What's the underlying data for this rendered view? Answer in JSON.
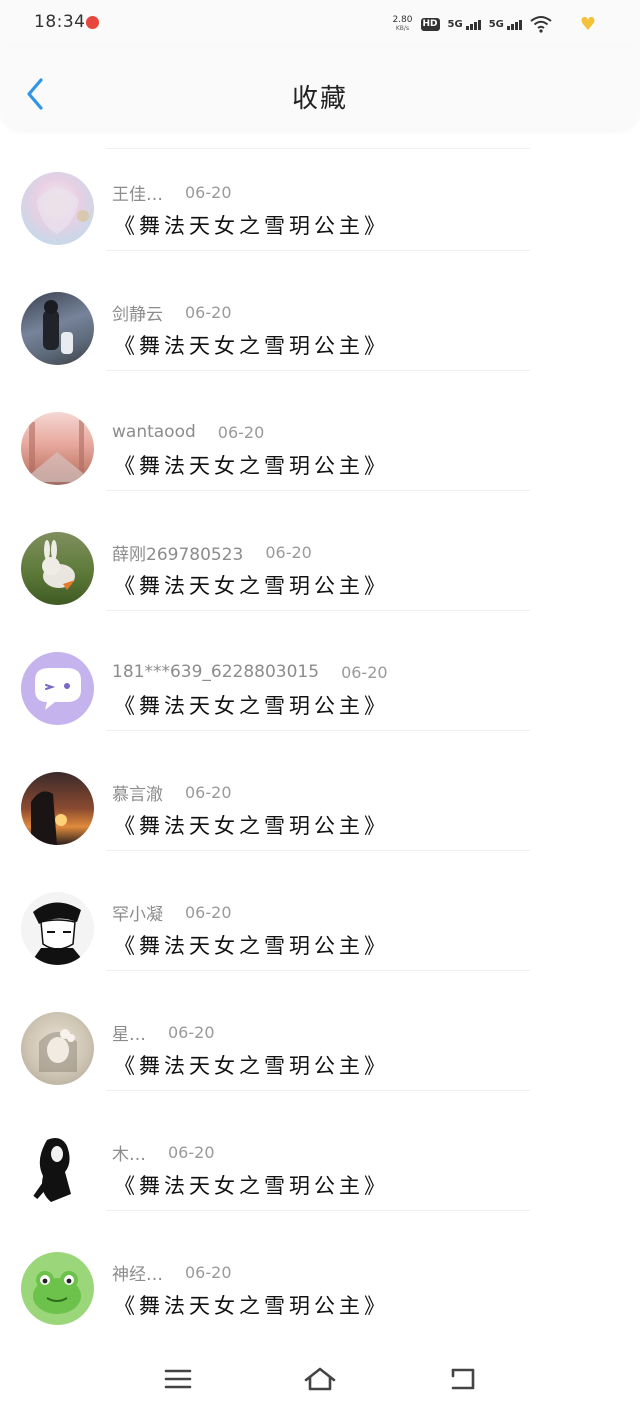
{
  "status_bar": {
    "time": "18:34",
    "net_speed_value": "2.80",
    "net_speed_unit": "KB/s",
    "hd_label": "HD",
    "signal_1_label": "5G",
    "signal_2_label": "5G"
  },
  "header": {
    "title": "收藏",
    "back_icon": "chevron-left-icon",
    "accent_color": "#2f95ea"
  },
  "items": [
    {
      "user": "王佳…",
      "date": "06-20",
      "title": "《舞法天女之雪玥公主》"
    },
    {
      "user": "剑静云",
      "date": "06-20",
      "title": "《舞法天女之雪玥公主》"
    },
    {
      "user": "wantaood",
      "date": "06-20",
      "title": "《舞法天女之雪玥公主》"
    },
    {
      "user": "薛刚269780523",
      "date": "06-20",
      "title": "《舞法天女之雪玥公主》"
    },
    {
      "user": "181***639_6228803015",
      "date": "06-20",
      "title": "《舞法天女之雪玥公主》"
    },
    {
      "user": "慕言澈",
      "date": "06-20",
      "title": "《舞法天女之雪玥公主》"
    },
    {
      "user": "罕小凝",
      "date": "06-20",
      "title": "《舞法天女之雪玥公主》"
    },
    {
      "user": "星…",
      "date": "06-20",
      "title": "《舞法天女之雪玥公主》"
    },
    {
      "user": "木…",
      "date": "06-20",
      "title": "《舞法天女之雪玥公主》"
    },
    {
      "user": "神经…",
      "date": "06-20",
      "title": "《舞法天女之雪玥公主》"
    }
  ],
  "bottom_nav": {
    "menu_icon": "menu-icon",
    "home_icon": "home-icon",
    "back_icon": "return-icon"
  }
}
